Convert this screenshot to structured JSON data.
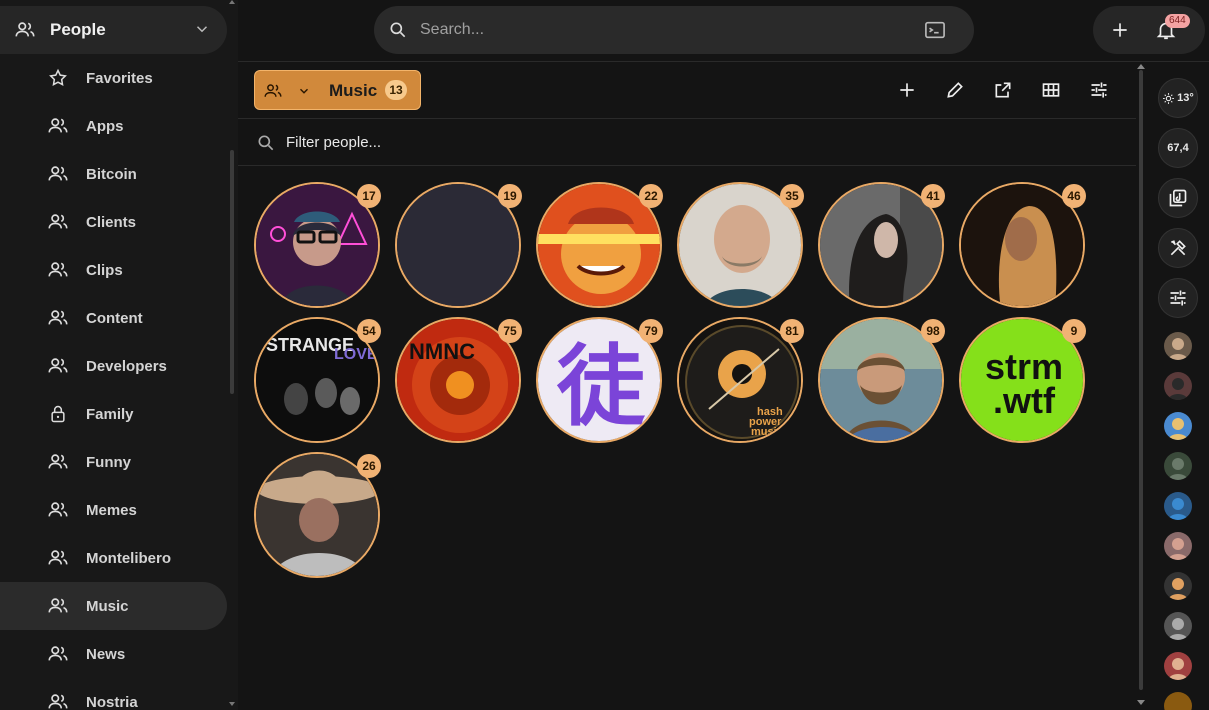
{
  "sidebar": {
    "header": {
      "title": "People"
    },
    "items": [
      {
        "label": "Favorites",
        "icon": "star-icon"
      },
      {
        "label": "Apps",
        "icon": "people-icon"
      },
      {
        "label": "Bitcoin",
        "icon": "people-icon"
      },
      {
        "label": "Clients",
        "icon": "people-icon"
      },
      {
        "label": "Clips",
        "icon": "people-icon"
      },
      {
        "label": "Content",
        "icon": "people-icon"
      },
      {
        "label": "Developers",
        "icon": "people-icon"
      },
      {
        "label": "Family",
        "icon": "lock-icon"
      },
      {
        "label": "Funny",
        "icon": "people-icon"
      },
      {
        "label": "Memes",
        "icon": "people-icon"
      },
      {
        "label": "Montelibero",
        "icon": "people-icon"
      },
      {
        "label": "Music",
        "icon": "people-icon",
        "active": true
      },
      {
        "label": "News",
        "icon": "people-icon"
      },
      {
        "label": "Nostria",
        "icon": "people-icon"
      }
    ]
  },
  "topbar": {
    "search_placeholder": "Search...",
    "notification_count": "644"
  },
  "group": {
    "name": "Music",
    "count": "13"
  },
  "filter": {
    "placeholder": "Filter people..."
  },
  "people": [
    {
      "badge": "17",
      "theme": "neon-glasses"
    },
    {
      "badge": "19",
      "theme": "empty"
    },
    {
      "badge": "22",
      "theme": "laser-eyes"
    },
    {
      "badge": "35",
      "theme": "bald-man"
    },
    {
      "badge": "41",
      "theme": "long-hair-profile"
    },
    {
      "badge": "46",
      "theme": "blonde-long-hair"
    },
    {
      "badge": "54",
      "theme": "strange-love"
    },
    {
      "badge": "75",
      "theme": "red-vinyl"
    },
    {
      "badge": "79",
      "theme": "purple-kanji",
      "glyph": "徒"
    },
    {
      "badge": "81",
      "theme": "hash-power-music",
      "lines": [
        "hash",
        "power",
        "music"
      ]
    },
    {
      "badge": "98",
      "theme": "bearded-man"
    },
    {
      "badge": "9",
      "theme": "strm-wtf",
      "lines": [
        "strm",
        ".wtf"
      ]
    },
    {
      "badge": "26",
      "theme": "cowboy-hat"
    }
  ],
  "rail": {
    "weather": "13°",
    "value": "67,4"
  },
  "colors": {
    "accent": "#d1893b",
    "badge": "#f1b274",
    "ring": "#e9a965"
  }
}
